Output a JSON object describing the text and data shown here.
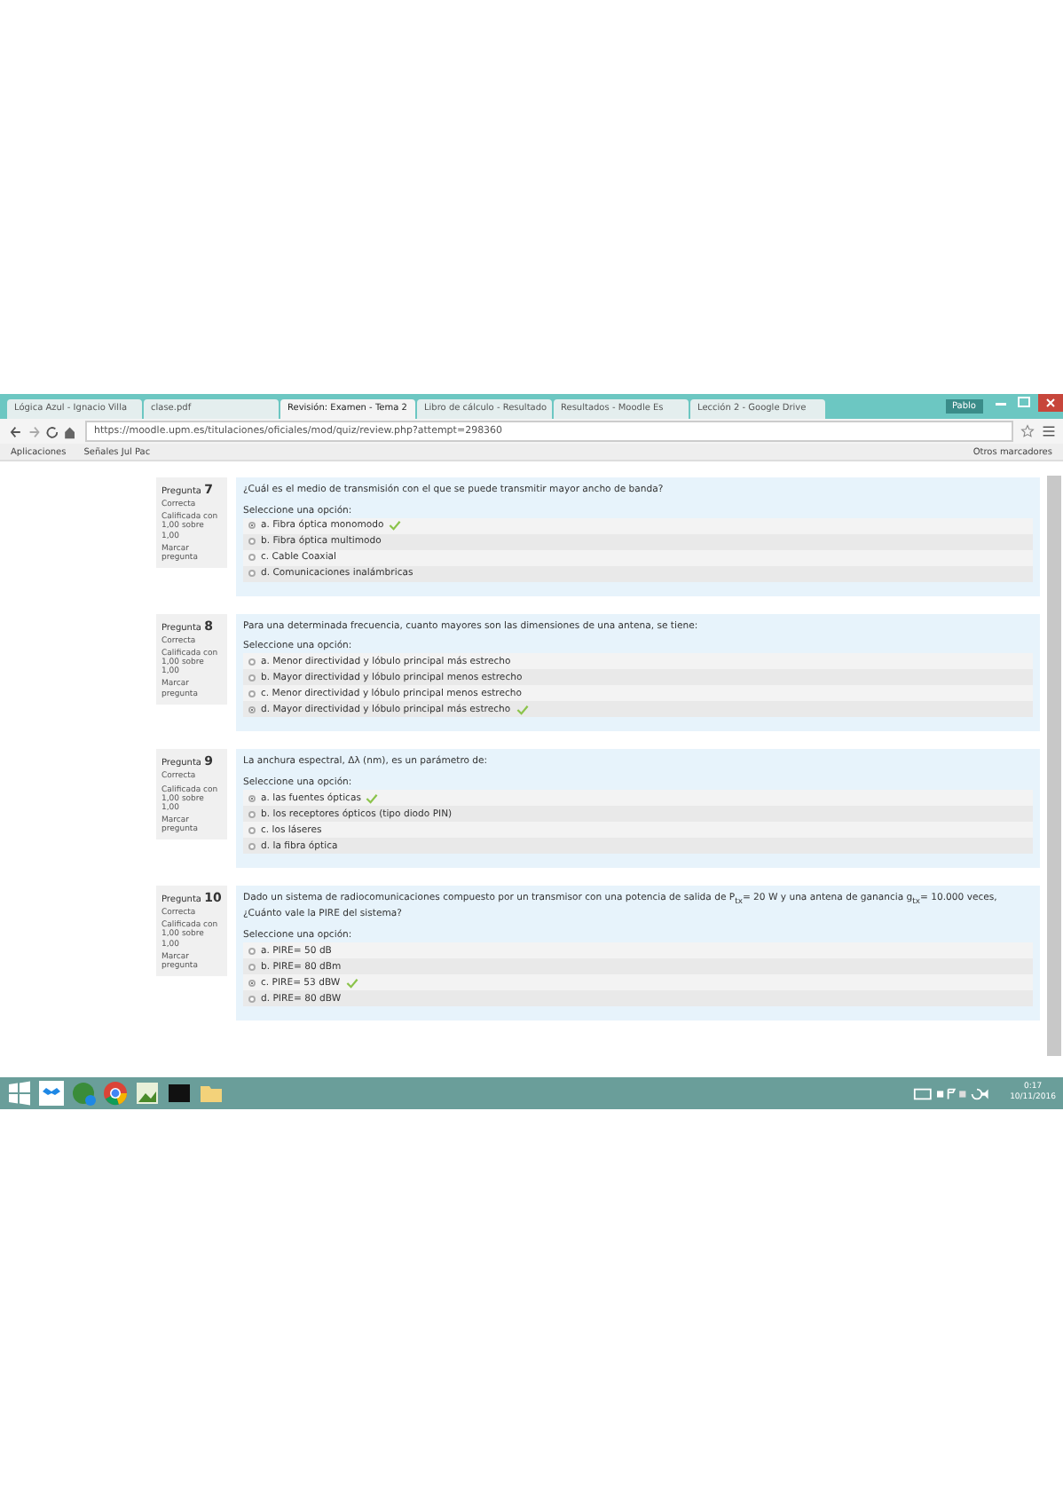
{
  "browser": {
    "tabs": [
      {
        "label": "Lógica Azul - Ignacio Villa",
        "selected": false
      },
      {
        "label": "clase.pdf",
        "selected": false
      },
      {
        "label": "Revisión: Examen - Tema 2",
        "selected": true
      },
      {
        "label": "Libro de cálculo - Resultado",
        "selected": false
      },
      {
        "label": "Resultados - Moodle Es",
        "selected": false
      },
      {
        "label": "Lección 2 - Google Drive",
        "selected": false
      }
    ],
    "user": "Pablo",
    "address": "https://moodle.upm.es/titulaciones/oficiales/mod/quiz/review.php?attempt=298360",
    "bookmarks": [
      "Aplicaciones",
      "Señales Jul Pac"
    ],
    "other_bookmarks": "Otros marcadores"
  },
  "questions": [
    {
      "label": "Pregunta",
      "number": "7",
      "status": "Correcta",
      "grade": "Calificada con 1,00 sobre 1,00",
      "flag": "Marcar pregunta",
      "text": "¿Cuál es el medio de transmisión con el que se puede transmitir mayor ancho de banda?",
      "prompt": "Seleccione una opción:",
      "options": [
        {
          "label": "a. Fibra óptica monomodo",
          "selected": true,
          "correct": true
        },
        {
          "label": "b. Fibra óptica multimodo",
          "selected": false,
          "correct": false
        },
        {
          "label": "c. Cable Coaxial",
          "selected": false,
          "correct": false
        },
        {
          "label": "d. Comunicaciones inalámbricas",
          "selected": false,
          "correct": false
        }
      ]
    },
    {
      "label": "Pregunta",
      "number": "8",
      "status": "Correcta",
      "grade": "Calificada con 1,00 sobre 1,00",
      "flag": "Marcar pregunta",
      "text": "Para una determinada frecuencia, cuanto mayores son las dimensiones de una antena, se tiene:",
      "prompt": "Seleccione una opción:",
      "options": [
        {
          "label": "a. Menor directividad y lóbulo principal más estrecho",
          "selected": false,
          "correct": false
        },
        {
          "label": "b. Mayor directividad y lóbulo principal menos estrecho",
          "selected": false,
          "correct": false
        },
        {
          "label": "c. Menor directividad y lóbulo principal menos estrecho",
          "selected": false,
          "correct": false
        },
        {
          "label": "d. Mayor directividad y lóbulo principal más estrecho",
          "selected": true,
          "correct": true
        }
      ]
    },
    {
      "label": "Pregunta",
      "number": "9",
      "status": "Correcta",
      "grade": "Calificada con 1,00 sobre 1,00",
      "flag": "Marcar pregunta",
      "text": "La anchura espectral, Δλ (nm), es un parámetro de:",
      "prompt": "Seleccione una opción:",
      "options": [
        {
          "label": "a. las fuentes ópticas",
          "selected": true,
          "correct": true
        },
        {
          "label": "b. los receptores ópticos (tipo diodo PIN)",
          "selected": false,
          "correct": false
        },
        {
          "label": "c. los láseres",
          "selected": false,
          "correct": false
        },
        {
          "label": "d. la fibra óptica",
          "selected": false,
          "correct": false
        }
      ]
    },
    {
      "label": "Pregunta",
      "number": "10",
      "status": "Correcta",
      "grade": "Calificada con 1,00 sobre 1,00",
      "flag": "Marcar pregunta",
      "text": "Dado un sistema de radiocomunicaciones compuesto por un transmisor con una potencia de salida de P$_{tx}$= 20 W y una antena de ganancia g$_{tx}$= 10.000 veces, ¿Cuánto vale la PIRE del sistema?",
      "prompt": "Seleccione una opción:",
      "options": [
        {
          "label": "a. PIRE= 50 dB",
          "selected": false,
          "correct": false
        },
        {
          "label": "b. PIRE= 80 dBm",
          "selected": false,
          "correct": false
        },
        {
          "label": "c. PIRE= 53 dBW",
          "selected": true,
          "correct": true
        },
        {
          "label": "d. PIRE= 80 dBW",
          "selected": false,
          "correct": false
        }
      ]
    }
  ],
  "taskbar": {
    "time": "0:17",
    "date": "10/11/2016"
  }
}
